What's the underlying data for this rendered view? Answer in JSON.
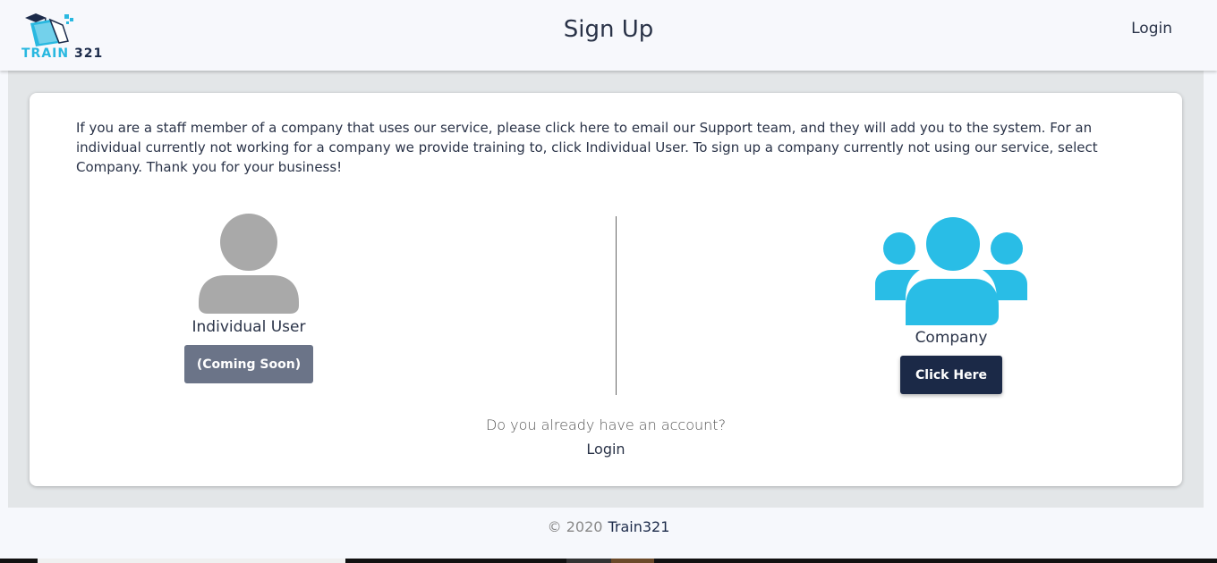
{
  "header": {
    "logo_text_1": "TRAIN",
    "logo_text_2": " 321",
    "title": "Sign Up",
    "login": "Login"
  },
  "card": {
    "intro": "If you are a staff member of a company that uses our service, please click here to email our Support team, and they will add you to the system. For an individual currently not working for a company we provide training to, click Individual User. To sign up a company currently not using our service, select Company. Thank you for your business!",
    "individual": {
      "label": "Individual User",
      "button": "(Coming Soon)",
      "icon": "user-icon"
    },
    "company": {
      "label": "Company",
      "button": "Click Here",
      "icon": "users-group-icon"
    },
    "account_question": "Do you already have an account?",
    "login_link": "Login"
  },
  "footer": {
    "copyright": "© 2020",
    "brand": "Train321"
  },
  "colors": {
    "accent": "#29b8e0",
    "navy": "#1b2947",
    "gray_button": "#6b7488",
    "gray_icon": "#a9a9a9"
  }
}
